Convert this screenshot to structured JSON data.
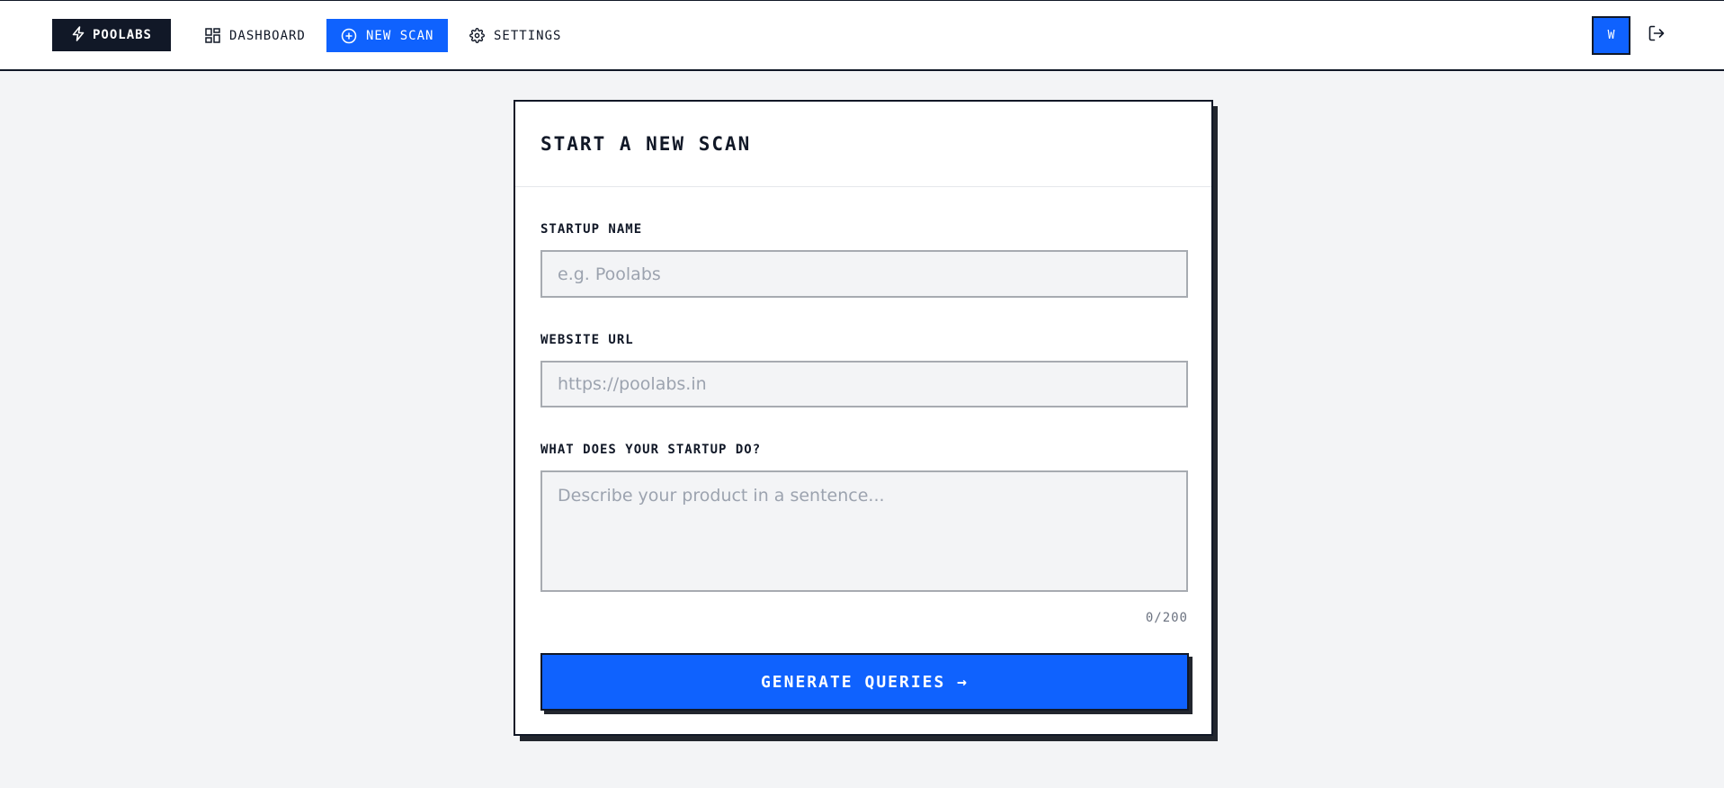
{
  "nav": {
    "brand": "POOLABS",
    "items": [
      {
        "label": "DASHBOARD",
        "icon": "grid-icon"
      },
      {
        "label": "NEW SCAN",
        "icon": "plus-circle-icon",
        "active": true
      },
      {
        "label": "SETTINGS",
        "icon": "gear-icon"
      }
    ],
    "avatar_initial": "W"
  },
  "form": {
    "title": "START A NEW SCAN",
    "startup_name": {
      "label": "STARTUP NAME",
      "placeholder": "e.g. Poolabs",
      "value": ""
    },
    "website_url": {
      "label": "WEBSITE URL",
      "placeholder": "https://poolabs.in",
      "value": ""
    },
    "description": {
      "label": "WHAT DOES YOUR STARTUP DO?",
      "placeholder": "Describe your product in a sentence...",
      "value": ""
    },
    "char_count": "0/200",
    "submit_label": "GENERATE QUERIES →"
  },
  "colors": {
    "accent": "#0f62fe",
    "dark": "#111827",
    "background": "#f3f4f6"
  }
}
